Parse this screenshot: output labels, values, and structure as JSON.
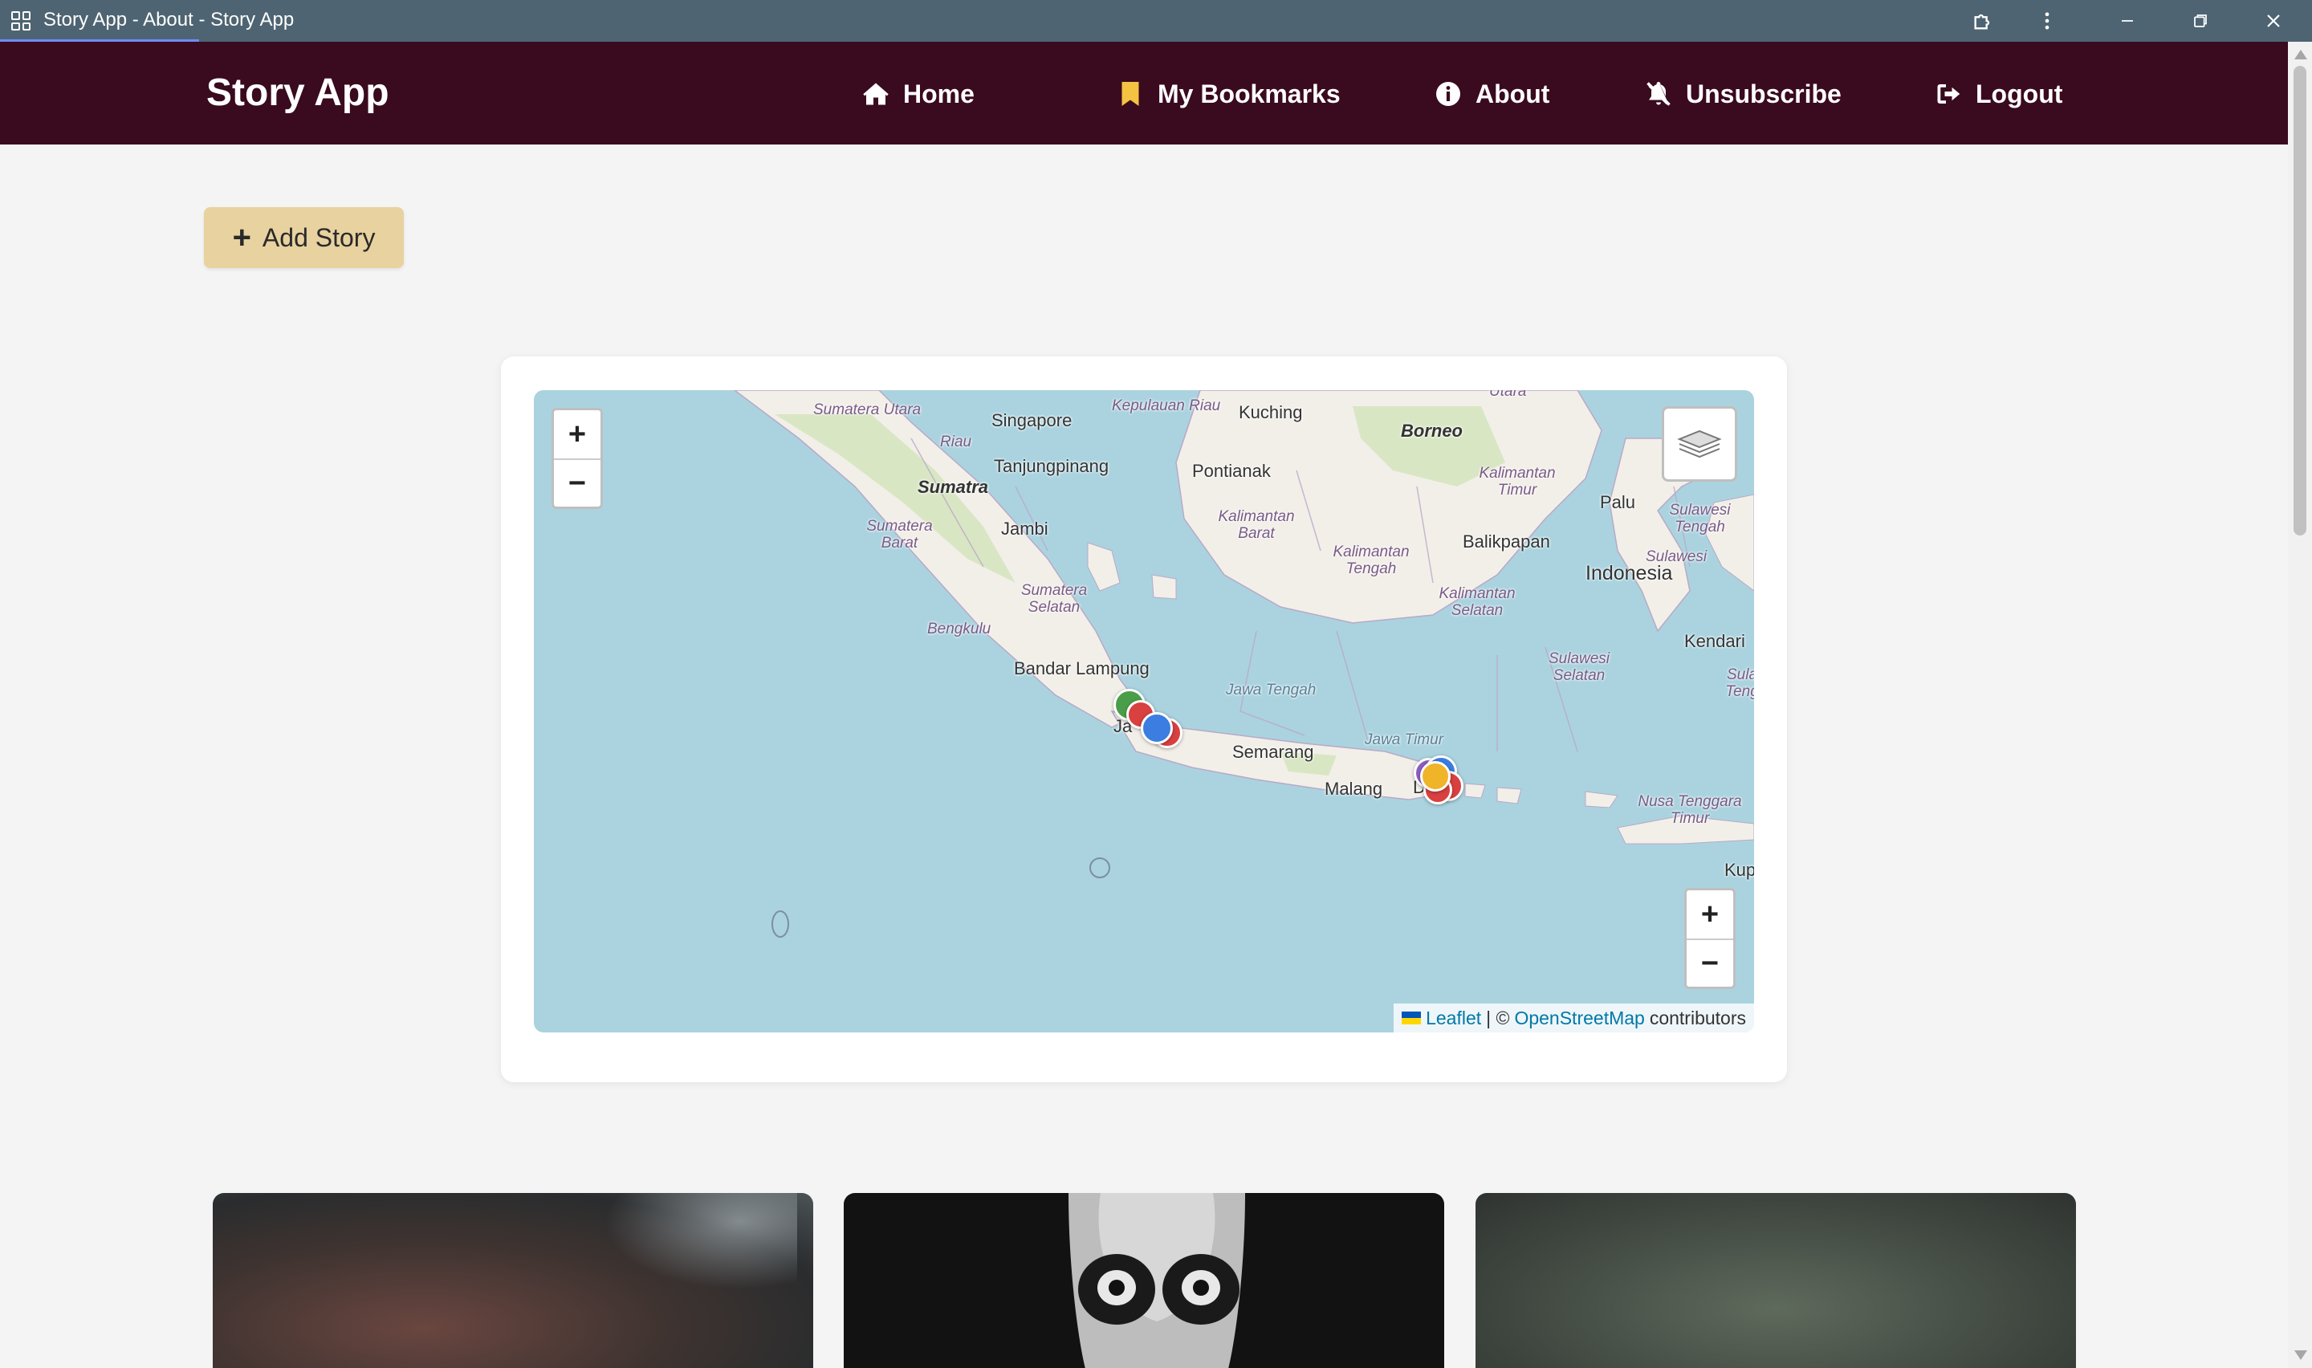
{
  "window": {
    "title": "Story App - About - Story App"
  },
  "header": {
    "brand": "Story App",
    "nav": [
      {
        "label": "Home",
        "icon": "home-icon"
      },
      {
        "label": "My Bookmarks",
        "icon": "bookmark-icon"
      },
      {
        "label": "About",
        "icon": "info-icon"
      },
      {
        "label": "Unsubscribe",
        "icon": "bell-slash-icon"
      },
      {
        "label": "Logout",
        "icon": "logout-icon"
      }
    ]
  },
  "actions": {
    "add_story_label": "Add Story"
  },
  "map": {
    "labels": {
      "sumatera_utara": "Sumatera Utara",
      "singapore": "Singapore",
      "kepulauan_riau": "Kepulauan Riau",
      "kuching": "Kuching",
      "borneo": "Borneo",
      "utara": "Utara",
      "riau": "Riau",
      "tanjungpinang": "Tanjungpinang",
      "pontianak": "Pontianak",
      "sumatra": "Sumatra",
      "kalimantan_timur": "Kalimantan Timur",
      "palu": "Palu",
      "sulawesi_tengah": "Sulawesi Tengah",
      "sumatera_barat": "Sumatera Barat",
      "jambi": "Jambi",
      "kalimantan_barat": "Kalimantan Barat",
      "balikpapan": "Balikpapan",
      "sulawesi": "Sulawesi",
      "indonesia": "Indonesia",
      "kalimantan_tengah": "Kalimantan Tengah",
      "sumatera_selatan": "Sumatera Selatan",
      "kalimantan_selatan": "Kalimantan Selatan",
      "bengkulu": "Bengkulu",
      "kendari": "Kendari",
      "sulawesi_selatan": "Sulawesi Selatan",
      "bandar_lampung": "Bandar Lampung",
      "jawa_tengah": "Jawa Tengah",
      "sula": "Sula Teng",
      "jawa_timur": "Jawa Timur",
      "ja": "Ja",
      "semarang": "Semarang",
      "malang": "Malang",
      "denpasar_frag": "D ar",
      "nusa_tenggara_timur": "Nusa Tenggara Timur",
      "kup": "Kup"
    },
    "zoom_in": "+",
    "zoom_out": "−",
    "markers": [
      {
        "color": "#4a9e4a",
        "group": "jakarta"
      },
      {
        "color": "#d94040",
        "group": "jakarta"
      },
      {
        "color": "#3b7de0",
        "group": "jakarta"
      },
      {
        "color": "#d94040",
        "group": "jakarta"
      },
      {
        "color": "#8c5fc4",
        "group": "bali"
      },
      {
        "color": "#3b7de0",
        "group": "bali"
      },
      {
        "color": "#d94040",
        "group": "bali"
      },
      {
        "color": "#d94040",
        "group": "bali"
      },
      {
        "color": "#f0b429",
        "group": "bali"
      }
    ],
    "attribution": {
      "leaflet": "Leaflet",
      "separator": "| ©",
      "osm": "OpenStreetMap",
      "suffix": "contributors"
    }
  },
  "colors": {
    "header_bg": "#3a0a1f",
    "add_story_bg": "#e8d29f",
    "bookmark_icon": "#f5c342",
    "titlebar_bg": "#4e6472"
  }
}
